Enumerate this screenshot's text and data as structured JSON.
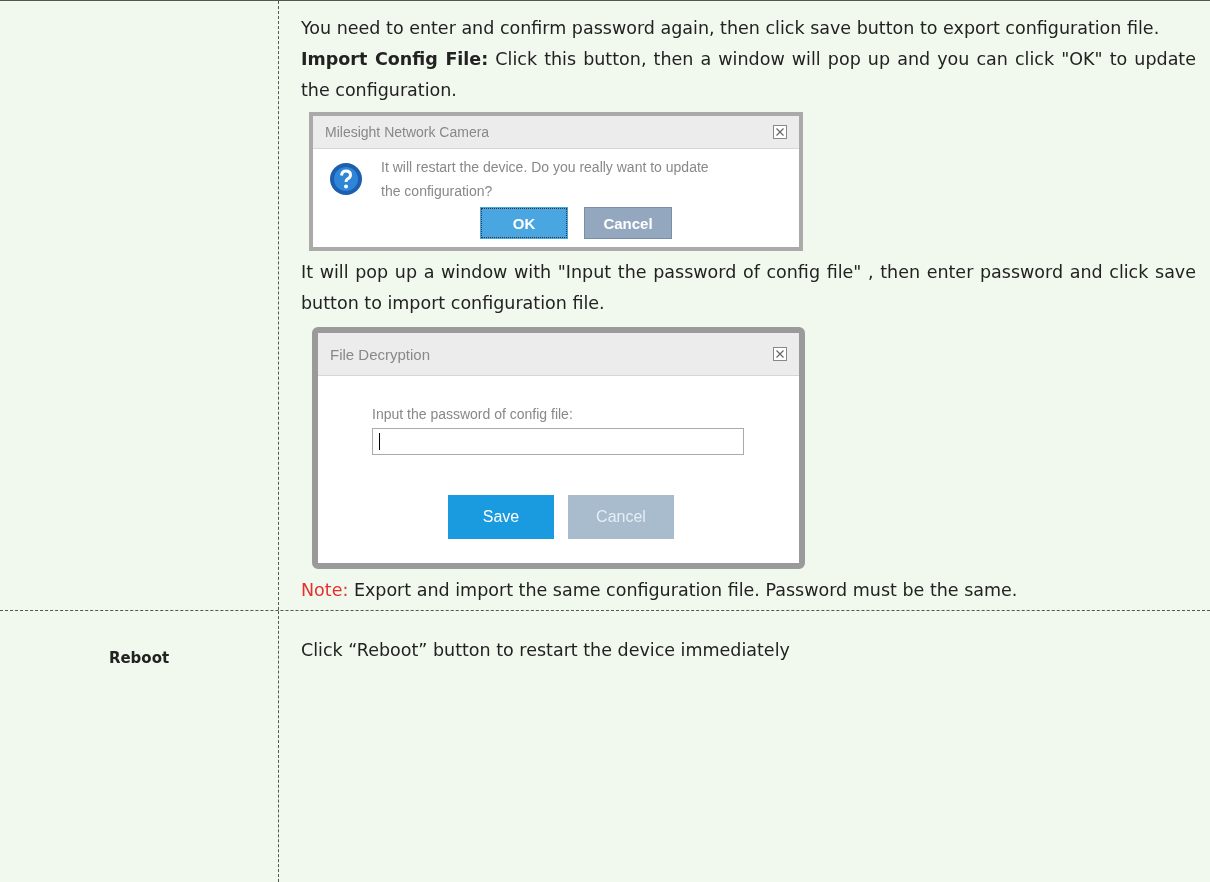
{
  "rows": [
    {
      "content": [
        {
          "kind": "text",
          "text": "You need to enter and confirm password again, then click save button to export configuration file."
        },
        {
          "kind": "text",
          "text": "**Import Config File:** Click this button, then a window will pop up and you can click \"OK\" to update the configuration."
        },
        {
          "kind": "confirm_dialog",
          "title": "Milesight Network Camera",
          "message": "It will restart the device. Do you really want to update the configuration?",
          "buttons": [
            {
              "label": "OK",
              "kind": "primary",
              "focused": true
            },
            {
              "label": "Cancel",
              "kind": "secondary",
              "focused": false
            }
          ]
        },
        {
          "kind": "text",
          "text": "It will pop up a window with \"Input the password of config file\" , then enter password and click save button to import configuration file."
        },
        {
          "kind": "password_dialog",
          "title": "File Decryption",
          "field_label": "Input the password of config file:",
          "buttons": [
            {
              "label": "Save",
              "kind": "primary",
              "focused": false
            },
            {
              "label": "Cancel",
              "kind": "secondary",
              "focused": false
            }
          ]
        },
        {
          "kind": "note",
          "label": "Note:",
          "text": "Export and import the same configuration file. Password must be the same."
        }
      ]
    },
    {
      "label": "Reboot",
      "content": [
        {
          "kind": "text",
          "text": "Click “Reboot” button to restart the device immediately"
        }
      ]
    }
  ]
}
